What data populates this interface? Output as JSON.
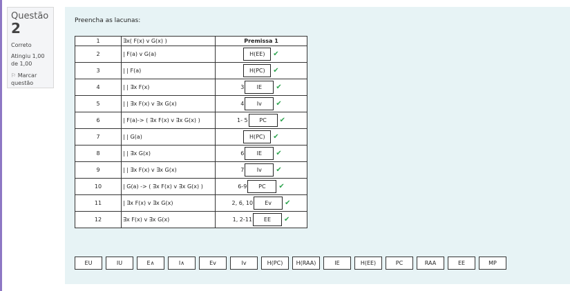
{
  "sidebar": {
    "question_label": "Questão",
    "question_number": "2",
    "state": "Correto",
    "grade": "Atingiu 1,00 de 1,00",
    "flag_label": "Marcar questão"
  },
  "question": {
    "prompt": "Preencha as lacunas:"
  },
  "proof_rows": [
    {
      "n": "1",
      "formula": "∃x( F(x) v G(x) )",
      "ref": "",
      "answer": "Premissa 1",
      "premise": true
    },
    {
      "n": "2",
      "formula": "| F(a) v G(a)",
      "ref": "",
      "answer": "H(EE)"
    },
    {
      "n": "3",
      "formula": "| | F(a)",
      "ref": "",
      "answer": "H(PC)"
    },
    {
      "n": "4",
      "formula": "| | ∃x F(x)",
      "ref": "3",
      "answer": "IE"
    },
    {
      "n": "5",
      "formula": "| | ∃x F(x) v ∃x G(x)",
      "ref": "4",
      "answer": "Iv"
    },
    {
      "n": "6",
      "formula": "| F(a)-> ( ∃x F(x) v ∃x G(x) )",
      "ref": "1- 5",
      "answer": "PC"
    },
    {
      "n": "7",
      "formula": "| | G(a)",
      "ref": "",
      "answer": "H(PC)"
    },
    {
      "n": "8",
      "formula": "| | ∃x G(x)",
      "ref": "6",
      "answer": "IE"
    },
    {
      "n": "9",
      "formula": "| | ∃x F(x) v ∃x G(x)",
      "ref": "7",
      "answer": "Iv"
    },
    {
      "n": "10",
      "formula": "| G(a) -> ( ∃x F(x) v ∃x G(x) )",
      "ref": "6-9",
      "answer": "PC"
    },
    {
      "n": "11",
      "formula": "| ∃x F(x) v ∃x G(x)",
      "ref": "2, 6, 10",
      "answer": "Ev"
    },
    {
      "n": "12",
      "formula": "∃x F(x) v ∃x G(x)",
      "ref": "1, 2-11",
      "answer": "EE"
    }
  ],
  "choices": [
    "EU",
    "IU",
    "E∧",
    "I∧",
    "Ev",
    "Iv",
    "H(PC)",
    "H(RAA)",
    "IE",
    "H(EE)",
    "PC",
    "RAA",
    "EE",
    "MP"
  ],
  "colors": {
    "check": "#2ea44f",
    "accent": "#8d77c4",
    "content_bg": "#e7f3f5"
  }
}
